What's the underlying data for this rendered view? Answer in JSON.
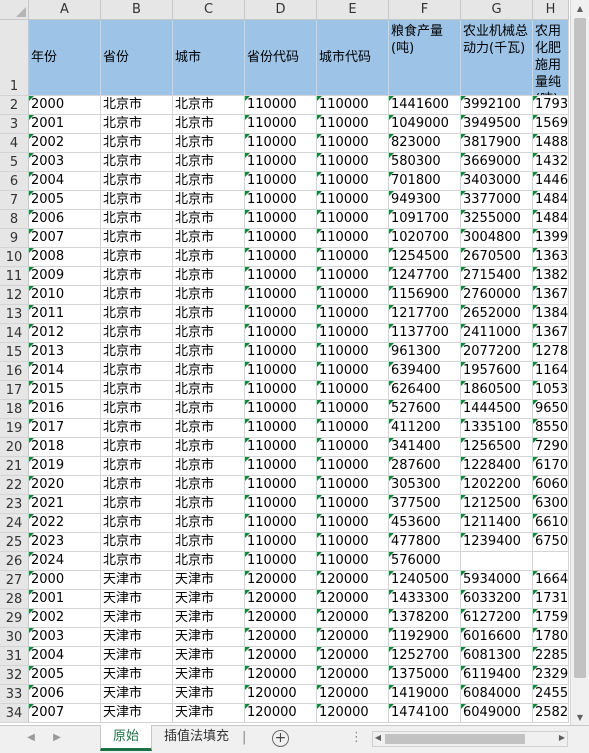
{
  "columns": [
    "A",
    "B",
    "C",
    "D",
    "E",
    "F",
    "G",
    "H"
  ],
  "header_row": {
    "row_number": "1",
    "labels": [
      "年份",
      "省份",
      "城市",
      "省份代码",
      "城市代码",
      "粮食产量(吨)",
      "农业机械总动力(千瓦)",
      "农用化肥施用量纯(吨)"
    ]
  },
  "rows": [
    {
      "n": "2",
      "c": [
        "2000",
        "北京市",
        "北京市",
        "110000",
        "110000",
        "1441600",
        "3992100",
        "1793"
      ]
    },
    {
      "n": "3",
      "c": [
        "2001",
        "北京市",
        "北京市",
        "110000",
        "110000",
        "1049000",
        "3949500",
        "1569"
      ]
    },
    {
      "n": "4",
      "c": [
        "2002",
        "北京市",
        "北京市",
        "110000",
        "110000",
        "823000",
        "3817900",
        "1488"
      ]
    },
    {
      "n": "5",
      "c": [
        "2003",
        "北京市",
        "北京市",
        "110000",
        "110000",
        "580300",
        "3669000",
        "1432"
      ]
    },
    {
      "n": "6",
      "c": [
        "2004",
        "北京市",
        "北京市",
        "110000",
        "110000",
        "701800",
        "3403000",
        "1446"
      ]
    },
    {
      "n": "7",
      "c": [
        "2005",
        "北京市",
        "北京市",
        "110000",
        "110000",
        "949300",
        "3377000",
        "1484"
      ]
    },
    {
      "n": "8",
      "c": [
        "2006",
        "北京市",
        "北京市",
        "110000",
        "110000",
        "1091700",
        "3255000",
        "1484"
      ]
    },
    {
      "n": "9",
      "c": [
        "2007",
        "北京市",
        "北京市",
        "110000",
        "110000",
        "1020700",
        "3004800",
        "1399"
      ]
    },
    {
      "n": "10",
      "c": [
        "2008",
        "北京市",
        "北京市",
        "110000",
        "110000",
        "1254500",
        "2670500",
        "1363"
      ]
    },
    {
      "n": "11",
      "c": [
        "2009",
        "北京市",
        "北京市",
        "110000",
        "110000",
        "1247700",
        "2715400",
        "1382"
      ]
    },
    {
      "n": "12",
      "c": [
        "2010",
        "北京市",
        "北京市",
        "110000",
        "110000",
        "1156900",
        "2760000",
        "1367"
      ]
    },
    {
      "n": "13",
      "c": [
        "2011",
        "北京市",
        "北京市",
        "110000",
        "110000",
        "1217700",
        "2652000",
        "1384"
      ]
    },
    {
      "n": "14",
      "c": [
        "2012",
        "北京市",
        "北京市",
        "110000",
        "110000",
        "1137700",
        "2411000",
        "1367"
      ]
    },
    {
      "n": "15",
      "c": [
        "2013",
        "北京市",
        "北京市",
        "110000",
        "110000",
        "961300",
        "2077200",
        "1278"
      ]
    },
    {
      "n": "16",
      "c": [
        "2014",
        "北京市",
        "北京市",
        "110000",
        "110000",
        "639400",
        "1957600",
        "1164"
      ]
    },
    {
      "n": "17",
      "c": [
        "2015",
        "北京市",
        "北京市",
        "110000",
        "110000",
        "626400",
        "1860500",
        "1053"
      ]
    },
    {
      "n": "18",
      "c": [
        "2016",
        "北京市",
        "北京市",
        "110000",
        "110000",
        "527600",
        "1444500",
        "9650"
      ]
    },
    {
      "n": "19",
      "c": [
        "2017",
        "北京市",
        "北京市",
        "110000",
        "110000",
        "411200",
        "1335100",
        "8550"
      ]
    },
    {
      "n": "20",
      "c": [
        "2018",
        "北京市",
        "北京市",
        "110000",
        "110000",
        "341400",
        "1256500",
        "7290"
      ]
    },
    {
      "n": "21",
      "c": [
        "2019",
        "北京市",
        "北京市",
        "110000",
        "110000",
        "287600",
        "1228400",
        "6170"
      ]
    },
    {
      "n": "22",
      "c": [
        "2020",
        "北京市",
        "北京市",
        "110000",
        "110000",
        "305300",
        "1202200",
        "6060"
      ]
    },
    {
      "n": "23",
      "c": [
        "2021",
        "北京市",
        "北京市",
        "110000",
        "110000",
        "377500",
        "1212500",
        "6300"
      ]
    },
    {
      "n": "24",
      "c": [
        "2022",
        "北京市",
        "北京市",
        "110000",
        "110000",
        "453600",
        "1211400",
        "6610"
      ]
    },
    {
      "n": "25",
      "c": [
        "2023",
        "北京市",
        "北京市",
        "110000",
        "110000",
        "477800",
        "1239400",
        "6750"
      ]
    },
    {
      "n": "26",
      "c": [
        "2024",
        "北京市",
        "北京市",
        "110000",
        "110000",
        "576000",
        "",
        ""
      ]
    },
    {
      "n": "27",
      "c": [
        "2000",
        "天津市",
        "天津市",
        "120000",
        "120000",
        "1240500",
        "5934000",
        "1664"
      ]
    },
    {
      "n": "28",
      "c": [
        "2001",
        "天津市",
        "天津市",
        "120000",
        "120000",
        "1433300",
        "6033200",
        "1731"
      ]
    },
    {
      "n": "29",
      "c": [
        "2002",
        "天津市",
        "天津市",
        "120000",
        "120000",
        "1378200",
        "6127200",
        "1759"
      ]
    },
    {
      "n": "30",
      "c": [
        "2003",
        "天津市",
        "天津市",
        "120000",
        "120000",
        "1192900",
        "6016600",
        "1780"
      ]
    },
    {
      "n": "31",
      "c": [
        "2004",
        "天津市",
        "天津市",
        "120000",
        "120000",
        "1252700",
        "6081300",
        "2285"
      ]
    },
    {
      "n": "32",
      "c": [
        "2005",
        "天津市",
        "天津市",
        "120000",
        "120000",
        "1375000",
        "6119400",
        "2329"
      ]
    },
    {
      "n": "33",
      "c": [
        "2006",
        "天津市",
        "天津市",
        "120000",
        "120000",
        "1419000",
        "6084000",
        "2455"
      ]
    },
    {
      "n": "34",
      "c": [
        "2007",
        "天津市",
        "天津市",
        "120000",
        "120000",
        "1474100",
        "6049000",
        "2582"
      ]
    }
  ],
  "tabs": [
    {
      "label": "原始",
      "active": true
    },
    {
      "label": "插值法填充",
      "active": false
    }
  ],
  "colors": {
    "header_fill": "#9dc3e6",
    "active_tab": "#1e7145",
    "error_indicator": "#0a8a3a"
  }
}
